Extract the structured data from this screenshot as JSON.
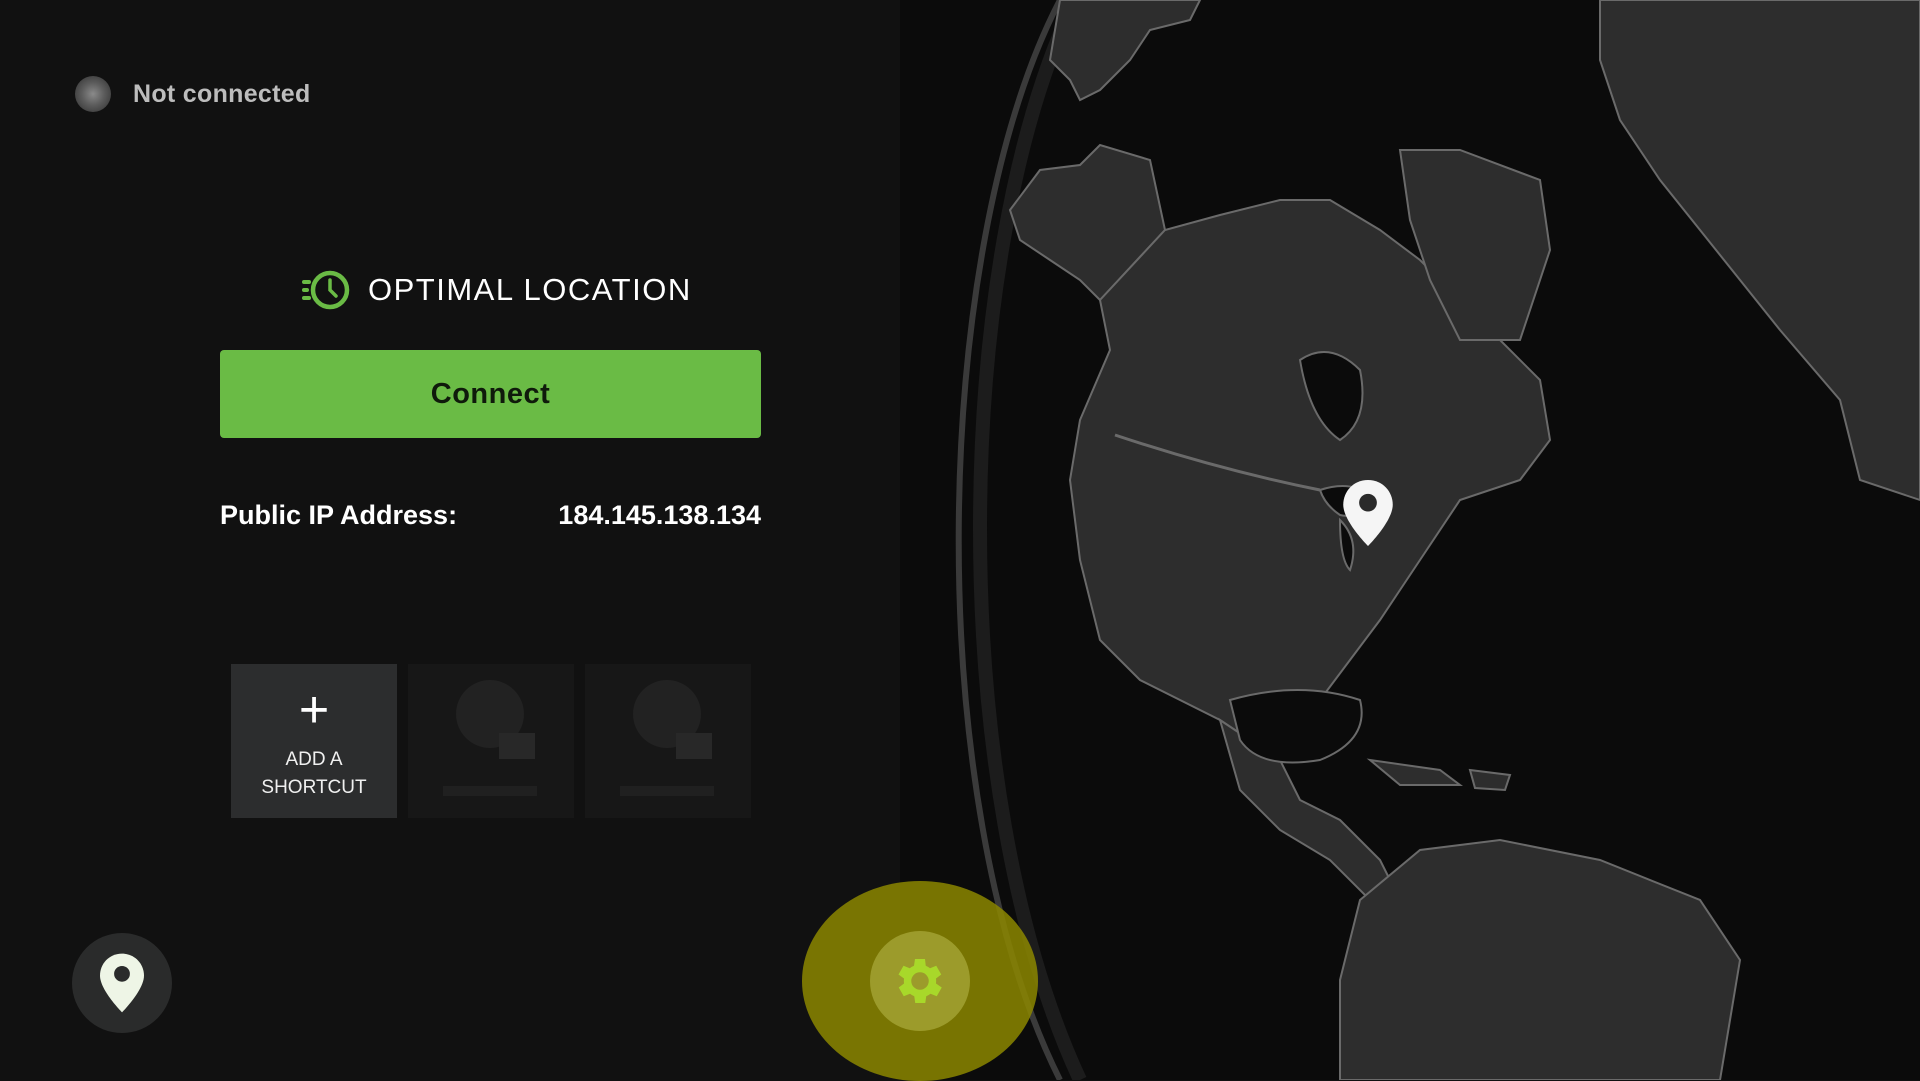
{
  "status": {
    "label": "Not connected",
    "dot_color": "#6b6b6b"
  },
  "location": {
    "icon": "fast-clock-icon",
    "label": "OPTIMAL LOCATION"
  },
  "connect": {
    "label": "Connect",
    "color": "#6abb45"
  },
  "ip": {
    "label": "Public IP Address:",
    "value": "184.145.138.134"
  },
  "shortcuts": {
    "add": {
      "icon": "plus-icon",
      "line1": "ADD A",
      "line2": "SHORTCUT"
    },
    "placeholders": 2
  },
  "bottom": {
    "locations_icon": "map-pin-icon",
    "settings_icon": "gear-icon",
    "accent": "#a8d82a"
  },
  "map": {
    "marker_icon": "map-pin-icon",
    "marker_region": "Great Lakes, North America"
  }
}
